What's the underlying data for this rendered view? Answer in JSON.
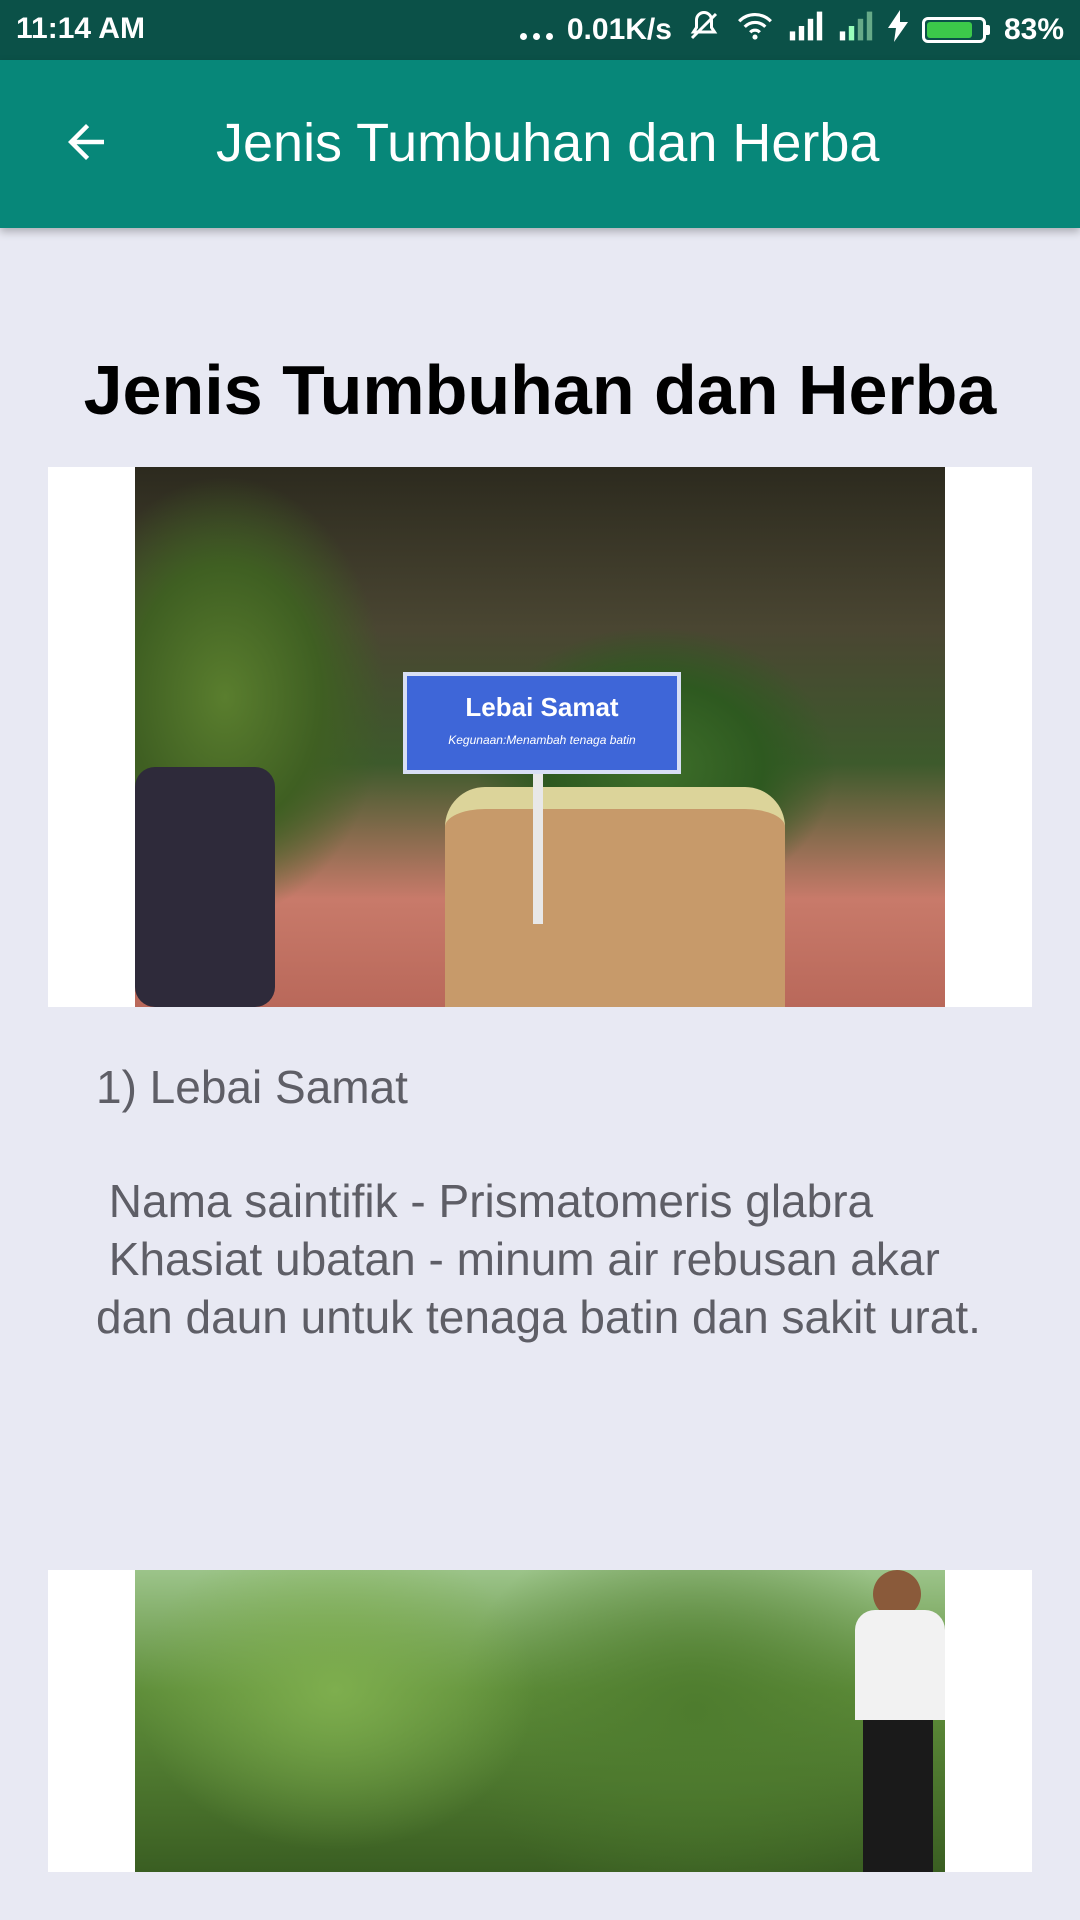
{
  "status_bar": {
    "time": "11:14 AM",
    "network_speed": "0.01K/s",
    "battery_percent": "83%",
    "battery_level": 0.83,
    "icons": [
      "more-dots-icon",
      "mute-icon",
      "wifi-icon",
      "signal-icon",
      "signal-icon",
      "charging-icon",
      "battery-icon"
    ]
  },
  "app_bar": {
    "back_icon": "arrow-back-icon",
    "title": "Jenis Tumbuhan dan Herba"
  },
  "content": {
    "heading": "Jenis Tumbuhan dan Herba",
    "items": [
      {
        "title": "1) Lebai Samat",
        "description": " Nama saintifik - Prismatomeris glabra\n Khasiat ubatan - minum air rebusan akar dan daun untuk tenaga batin dan sakit urat.",
        "image_sign_title": "Lebai Samat",
        "image_sign_subtitle": "Kegunaan:Menambah tenaga batin"
      }
    ]
  },
  "colors": {
    "status_bar": "#0B5148",
    "app_bar": "#078779",
    "background": "#E8E9F3",
    "body_text": "#5E5E66"
  }
}
